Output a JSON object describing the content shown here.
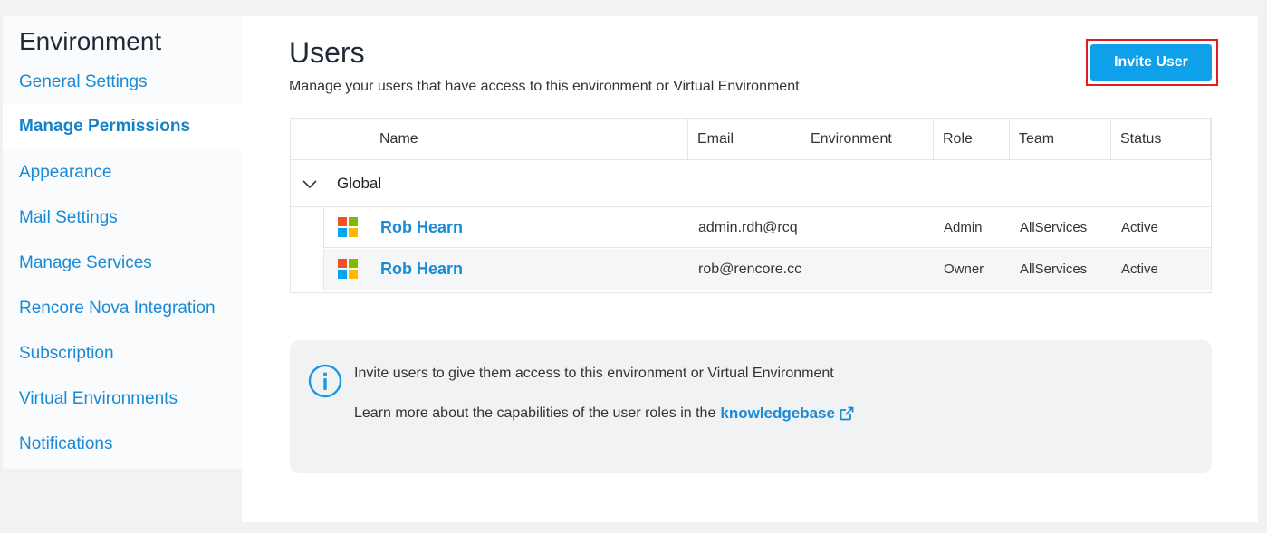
{
  "sidebar": {
    "title": "Environment",
    "items": [
      {
        "label": "General Settings"
      },
      {
        "label": "Manage Permissions"
      },
      {
        "label": "Appearance"
      },
      {
        "label": "Mail Settings"
      },
      {
        "label": "Manage Services"
      },
      {
        "label": "Rencore Nova Integration"
      },
      {
        "label": "Subscription"
      },
      {
        "label": "Virtual Environments"
      },
      {
        "label": "Notifications"
      }
    ],
    "active_index": 1
  },
  "main": {
    "title": "Users",
    "subtitle": "Manage your users that have access to this environment or Virtual Environment",
    "invite_button": "Invite User"
  },
  "table": {
    "columns": [
      "Name",
      "Email",
      "Environment",
      "Role",
      "Team",
      "Status"
    ],
    "group": "Global",
    "rows": [
      {
        "name": "Rob Hearn",
        "email": "admin.rdh@rcq",
        "environment": "",
        "role": "Admin",
        "team": "AllServices",
        "status": "Active",
        "icon": "microsoft-logo-icon"
      },
      {
        "name": "Rob Hearn",
        "email": "rob@rencore.cc",
        "environment": "",
        "role": "Owner",
        "team": "AllServices",
        "status": "Active",
        "icon": "microsoft-logo-icon"
      }
    ]
  },
  "info": {
    "line1": "Invite users to give them access to this environment or Virtual Environment",
    "line2_prefix": "Learn more about the capabilities of the user roles in the",
    "link_label": "knowledgebase"
  },
  "colors": {
    "accent": "#0ea0e8",
    "link": "#1a8ad4",
    "highlight": "#e01b2a",
    "ms_red": "#f25022",
    "ms_green": "#7fba00",
    "ms_blue": "#00a4ef",
    "ms_yellow": "#ffb900"
  }
}
